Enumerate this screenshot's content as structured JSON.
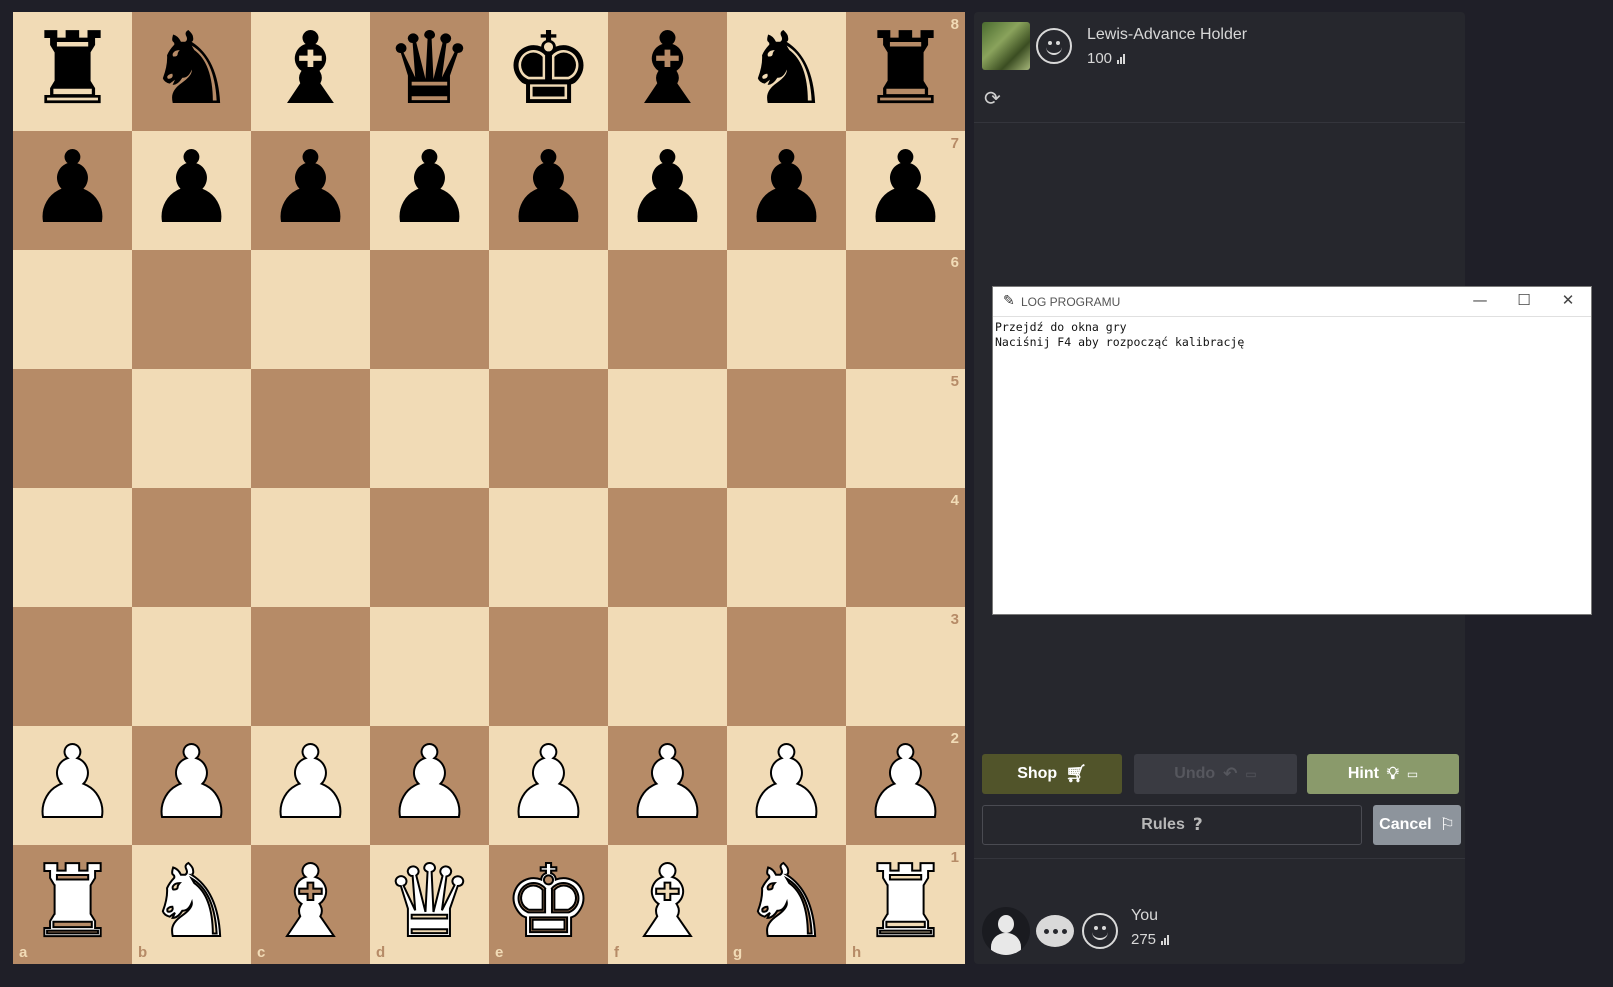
{
  "board": {
    "files": [
      "a",
      "b",
      "c",
      "d",
      "e",
      "f",
      "g",
      "h"
    ],
    "ranks": [
      "8",
      "7",
      "6",
      "5",
      "4",
      "3",
      "2",
      "1"
    ],
    "rows": [
      [
        "br",
        "bn",
        "bb",
        "bq",
        "bk",
        "bb",
        "bn",
        "br"
      ],
      [
        "bp",
        "bp",
        "bp",
        "bp",
        "bp",
        "bp",
        "bp",
        "bp"
      ],
      [
        "",
        "",
        "",
        "",
        "",
        "",
        "",
        ""
      ],
      [
        "",
        "",
        "",
        "",
        "",
        "",
        "",
        ""
      ],
      [
        "",
        "",
        "",
        "",
        "",
        "",
        "",
        ""
      ],
      [
        "",
        "",
        "",
        "",
        "",
        "",
        "",
        ""
      ],
      [
        "wp",
        "wp",
        "wp",
        "wp",
        "wp",
        "wp",
        "wp",
        "wp"
      ],
      [
        "wr",
        "wn",
        "wb",
        "wq",
        "wk",
        "wb",
        "wn",
        "wr"
      ]
    ],
    "colors": {
      "light": "#f1dbb6",
      "dark": "#b68b67"
    }
  },
  "opponent": {
    "name": "Lewis-Advance Holder",
    "rating": "100"
  },
  "player": {
    "name": "You",
    "rating": "275"
  },
  "buttons": {
    "shop": "Shop",
    "undo": "Undo",
    "hint": "Hint",
    "rules": "Rules",
    "cancel": "Cancel"
  },
  "log_window": {
    "title": "LOG PROGRAMU",
    "lines": "Przejdź do okna gry\nNaciśnij F4 aby rozpocząć kalibrację"
  },
  "icons": {
    "refresh": "refresh-icon",
    "cart": "cart-icon",
    "undo": "undo-arrow-icon",
    "hint": "lightbulb-icon",
    "rules": "question-icon",
    "cancel": "flag-icon"
  }
}
